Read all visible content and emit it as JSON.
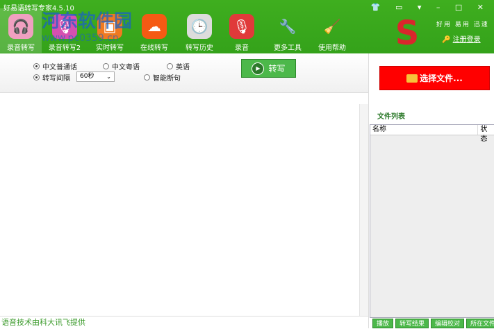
{
  "title": "好易语转写专家4.5.10",
  "toolbar": [
    {
      "label": "录音转写",
      "icon": "headset-icon",
      "color": "#f0a0c0"
    },
    {
      "label": "录音转写2",
      "icon": "mic-icon",
      "color": "#d650b0"
    },
    {
      "label": "实时转写",
      "icon": "print-icon",
      "color": "#f07a20"
    },
    {
      "label": "在线转写",
      "icon": "cloud-icon",
      "color": "#f55a14"
    },
    {
      "label": "转写历史",
      "icon": "clock-icon",
      "color": "#dcdcdc"
    },
    {
      "label": "录音",
      "icon": "mic-icon",
      "color": "#e03a3a"
    },
    {
      "label": "更多工具",
      "icon": "wrench-icon",
      "color": "transparent"
    },
    {
      "label": "使用帮助",
      "icon": "broom-icon",
      "color": "transparent"
    }
  ],
  "header": {
    "slogan": "好用 易用 迅速",
    "register": "注册登录",
    "window_controls": "👕 ▭ ▾ – □ ✕"
  },
  "options": {
    "lang1": "中文普通话",
    "lang2": "中文粤语",
    "lang3": "英语",
    "interval_label": "转写间隔",
    "interval_value": "60秒",
    "smart": "智能断句",
    "convert": "转写"
  },
  "right": {
    "choose": "选择文件...",
    "file_list": "文件列表",
    "col_name": "名称",
    "col_status": "状态",
    "buttons": [
      "播放",
      "转写结果",
      "编辑校对",
      "所在文件夹"
    ]
  },
  "status": "语音技术由科大讯飞提供",
  "watermark": {
    "name": "河东软件园",
    "url": "www.pc0359.cn"
  }
}
